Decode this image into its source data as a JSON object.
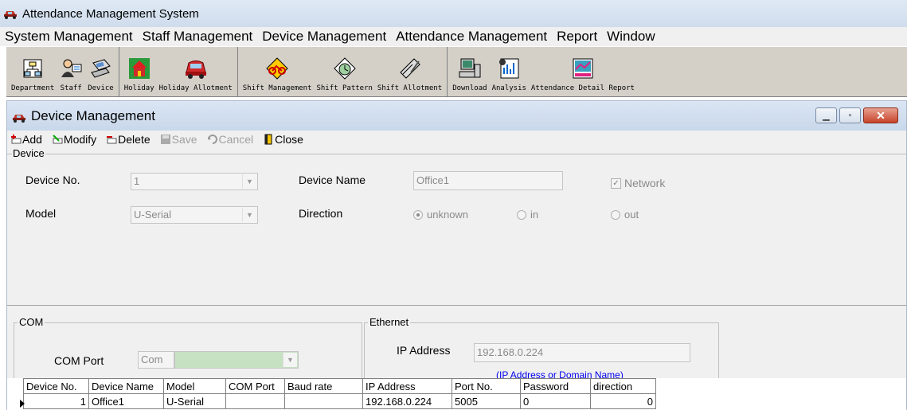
{
  "app": {
    "title": "Attendance Management System"
  },
  "menu": [
    "System Management",
    "Staff Management",
    "Device Management",
    "Attendance Management",
    "Report",
    "Window"
  ],
  "toolbar": {
    "group1": [
      {
        "label": "Department",
        "icon": "department-icon"
      },
      {
        "label": "Staff",
        "icon": "staff-icon"
      },
      {
        "label": "Device",
        "icon": "device-icon"
      }
    ],
    "group2": [
      {
        "label": "Holiday",
        "icon": "holiday-icon"
      },
      {
        "label": "Holiday Allotment",
        "icon": "holiday-allotment-icon"
      }
    ],
    "group3": [
      {
        "label": "Shift Management",
        "icon": "shift-management-icon"
      },
      {
        "label": "Shift Pattern",
        "icon": "shift-pattern-icon"
      },
      {
        "label": "Shift Allotment",
        "icon": "shift-allotment-icon"
      }
    ],
    "group4": [
      {
        "label": "Download",
        "icon": "download-icon"
      },
      {
        "label": "Analysis",
        "icon": "analysis-icon"
      },
      {
        "label": "Attendance Detail Report",
        "icon": "report-icon"
      }
    ]
  },
  "child": {
    "title": "Device Management",
    "actions": {
      "add": "Add",
      "modify": "Modify",
      "delete": "Delete",
      "save": "Save",
      "cancel": "Cancel",
      "close": "Close"
    },
    "device_group": "Device",
    "device_no_label": "Device No.",
    "device_no_value": "1",
    "device_name_label": "Device Name",
    "device_name_value": "Office1",
    "network_label": "Network",
    "network_checked": true,
    "model_label": "Model",
    "model_value": "U-Serial",
    "direction_label": "Direction",
    "direction_options": [
      "unknown",
      "in",
      "out"
    ],
    "direction_selected": "unknown",
    "com_group": "COM",
    "com_port_label": "COM Port",
    "com_port_value": "Com",
    "ethernet_group": "Ethernet",
    "ip_label": "IP Address",
    "ip_value": "192.168.0.224",
    "ip_hint": "(IP Address or Domain Name)"
  },
  "grid": {
    "columns": [
      "Device No.",
      "Device Name",
      "Model",
      "COM Port",
      "Baud rate",
      "IP Address",
      "Port No.",
      "Password",
      "direction"
    ],
    "rows": [
      [
        "1",
        "Office1",
        "U-Serial",
        "",
        "",
        "192.168.0.224",
        "5005",
        "0",
        "0"
      ]
    ]
  }
}
